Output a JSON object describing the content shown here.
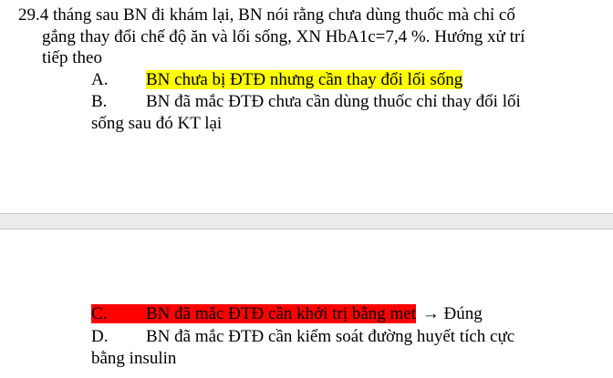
{
  "question": {
    "line1": "29.4 tháng sau BN đi khám lại, BN nói rằng chưa dùng thuốc mà chỉ cố",
    "line2": "gắng thay đổi chế độ ăn và lối sống, XN HbA1c=7,4 %. Hướng xử trí",
    "line3": "tiếp theo"
  },
  "options": {
    "a": {
      "letter": "A.",
      "text": "BN chưa bị ĐTĐ nhưng cần thay đổi lối sống"
    },
    "b": {
      "letter": "B.",
      "text": "BN đã mắc ĐTĐ chưa cần dùng thuốc chỉ thay đổi lối",
      "text_cont": "sống sau đó KT lại"
    },
    "c": {
      "letter": "C.",
      "text": "BN đã mắc ĐTĐ cần khởi trị bằng met",
      "arrow": "→",
      "verdict": "Đúng"
    },
    "d": {
      "letter": "D.",
      "text": "BN đã mắc ĐTĐ cần kiểm soát đường huyết tích cực",
      "text_cont": "bằng insulin"
    }
  },
  "colors": {
    "highlight_a": "#ffff00",
    "highlight_c": "#ff0000"
  }
}
